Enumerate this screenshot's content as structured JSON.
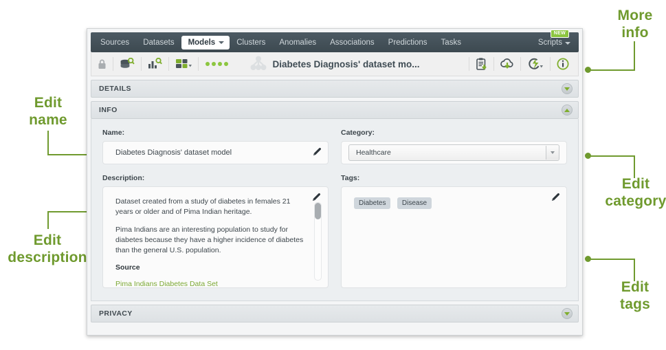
{
  "nav": {
    "items": [
      {
        "label": "Sources",
        "active": false
      },
      {
        "label": "Datasets",
        "active": false
      },
      {
        "label": "Models",
        "active": true
      },
      {
        "label": "Clusters",
        "active": false
      },
      {
        "label": "Anomalies",
        "active": false
      },
      {
        "label": "Associations",
        "active": false
      },
      {
        "label": "Predictions",
        "active": false
      },
      {
        "label": "Tasks",
        "active": false
      }
    ],
    "scripts_label": "Scripts",
    "new_badge": "NEW"
  },
  "toolbar": {
    "lock_icon": "lock-icon",
    "dataset_search_icon": "dataset-search-icon",
    "chart_search_icon": "chart-search-icon",
    "fields_icon": "fields-icon",
    "status_dots": "status-dots",
    "model_icon": "model-tree-icon",
    "title": "Diabetes Diagnosis' dataset mo...",
    "download_icon": "clipboard-download-icon",
    "cloud_icon": "cloud-download-icon",
    "batch_icon": "batch-prediction-icon",
    "info_icon": "info-icon"
  },
  "panels": {
    "details": "DETAILS",
    "info": "INFO",
    "privacy": "PRIVACY"
  },
  "info": {
    "name_label": "Name:",
    "name_value": "Diabetes Diagnosis' dataset model",
    "category_label": "Category:",
    "category_value": "Healthcare",
    "description_label": "Description:",
    "description_paragraphs": [
      "Dataset created from a study of diabetes in females 21 years or older and of Pima Indian heritage.",
      "Pima Indians are an interesting population to study for diabetes because they have a higher incidence of diabetes than the general U.S. population."
    ],
    "source_heading": "Source",
    "source_link": "Pima Indians Diabetes Data Set",
    "tags_label": "Tags:",
    "tags": [
      "Diabetes",
      "Disease"
    ]
  },
  "annotations": {
    "edit_name": "Edit\nname",
    "edit_name_line1": "Edit",
    "edit_name_line2": "name",
    "edit_description_line1": "Edit",
    "edit_description_line2": "description",
    "more_info_line1": "More",
    "more_info_line2": "info",
    "edit_category_line1": "Edit",
    "edit_category_line2": "category",
    "edit_tags_line1": "Edit",
    "edit_tags_line2": "tags",
    "color": "#6f9a2e"
  },
  "colors": {
    "accent_green": "#8cc63f",
    "nav_dark": "#3d4950",
    "text_dark": "#3d464c",
    "link_green": "#7ba832",
    "tag_bg": "#cfd6dc"
  }
}
